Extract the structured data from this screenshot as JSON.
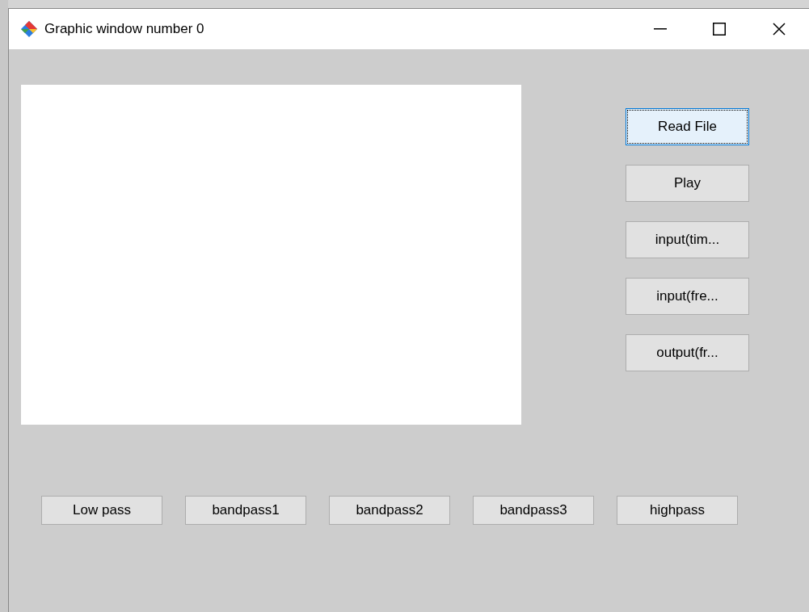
{
  "window": {
    "title": "Graphic window number 0"
  },
  "side_buttons": [
    {
      "label": "Read File",
      "focused": true
    },
    {
      "label": "Play",
      "focused": false
    },
    {
      "label": "input(tim...",
      "focused": false
    },
    {
      "label": "input(fre...",
      "focused": false
    },
    {
      "label": "output(fr...",
      "focused": false
    }
  ],
  "filter_buttons": [
    {
      "label": "Low pass",
      "focused": false
    },
    {
      "label": "bandpass1",
      "focused": false
    },
    {
      "label": "bandpass2",
      "focused": false
    },
    {
      "label": "bandpass3",
      "focused": false
    },
    {
      "label": "highpass",
      "focused": false
    }
  ]
}
